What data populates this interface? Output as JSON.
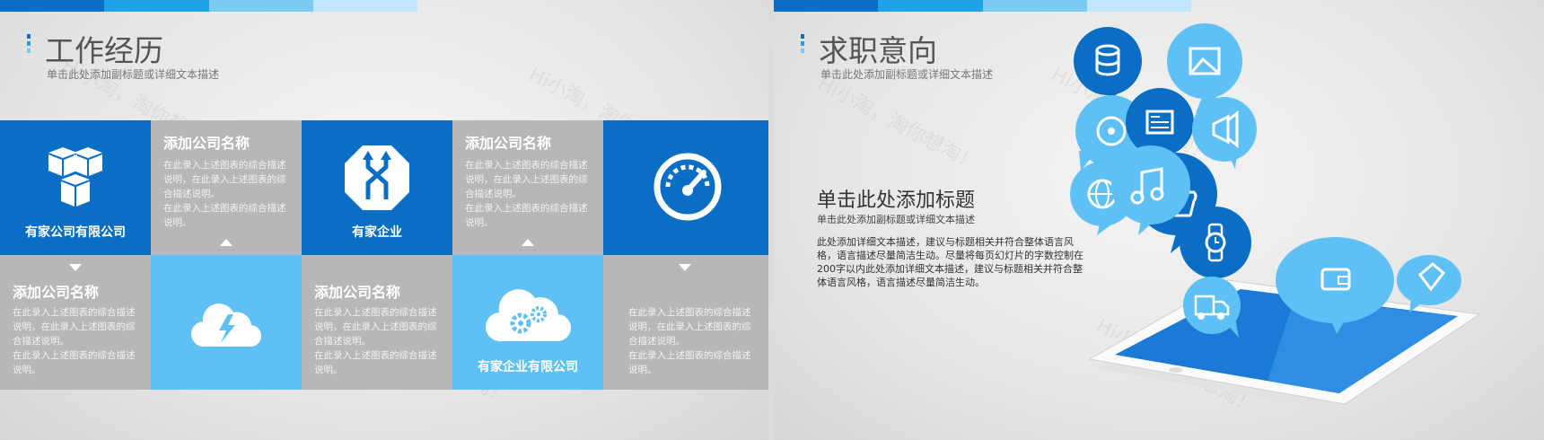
{
  "colors": {
    "dark_blue": "#0a6fc4",
    "mid_blue": "#1ea3e8",
    "light_blue": "#5ec0f5",
    "pale_blue": "#bfe6fb",
    "gray": "#b7b7b7"
  },
  "watermark": "Hi小淘，淘你想淘！",
  "left": {
    "title": "工作经历",
    "subtitle": "单击此处添加副标题或详细文本描述",
    "blocks": [
      {
        "icon": "cubes-icon",
        "name": "有家公司有限公司"
      },
      {
        "title": "添加公司名称",
        "desc": "在此录入上述图表的综合描述说明，在此录入上述图表的综合描述说明。\n在此录入上述图表的综合描述说明。"
      },
      {
        "icon": "merge-arrows-icon",
        "name": "有家企业"
      },
      {
        "title": "添加公司名称",
        "desc": "在此录入上述图表的综合描述说明，在此录入上述图表的综合描述说明。\n在此录入上述图表的综合描述说明。"
      },
      {
        "icon": "speedometer-icon"
      },
      {
        "title": "添加公司名称",
        "desc": "在此录入上述图表的综合描述说明，在此录入上述图表的综合描述说明。\n在此录入上述图表的综合描述说明。"
      },
      {
        "icon": "cloud-lightning-icon"
      },
      {
        "title": "添加公司名称",
        "desc": "在此录入上述图表的综合描述说明，在此录入上述图表的综合描述说明。\n在此录入上述图表的综合描述说明。"
      },
      {
        "icon": "cloud-gears-icon",
        "name": "有家企业有限公司"
      },
      {
        "desc": "在此录入上述图表的综合描述说明，在此录入上述图表的综合描述说明。\n在此录入上述图表的综合描述说明。"
      }
    ]
  },
  "right": {
    "title": "求职意向",
    "subtitle": "单击此处添加副标题或详细文本描述",
    "heading": "单击此处添加标题",
    "heading_sub": "单击此处添加副标题或详细文本描述",
    "body": "此处添加详细文本描述，建议与标题相关并符合整体语言风格，语言描述尽量简洁生动。尽量将每页幻灯片的字数控制在200字以内此处添加详细文本描述，建议与标题相关并符合整体语言风格，语言描述尽量简洁生动。",
    "bubbles": [
      "database-icon",
      "image-icon",
      "cd-icon",
      "newspaper-icon",
      "megaphone-icon",
      "music-icon",
      "globe-icon",
      "thumbs-up-icon",
      "watch-icon",
      "wallet-icon",
      "tag-icon",
      "truck-icon"
    ]
  }
}
